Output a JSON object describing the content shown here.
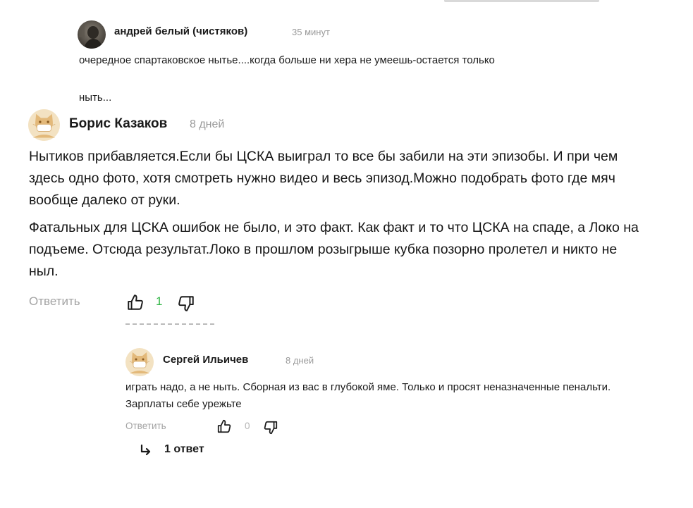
{
  "comments": [
    {
      "author": "андрей белый (чистяков)",
      "time": "35 минут",
      "text_line1": "очередное спартаковское нытье....когда больше ни хера не умеешь-остается только",
      "text_line2": "ныть..."
    },
    {
      "author": "Борис Казаков",
      "time": "8 дней",
      "paragraph1": "Нытиков прибавляется.Если бы ЦСКА выиграл то все бы забили на эти эпизобы. И при чем здесь одно фото, хотя смотреть нужно видео и весь эпизод.Можно подобрать фото где мяч вообще далеко от руки.",
      "paragraph2": "Фатальных для ЦСКА ошибок не было, и это факт. Как факт и то что ЦСКА на спаде, а Локо на подъеме. Отсюда результат.Локо в прошлом розыгрыше кубка позорно пролетел и никто не ныл.",
      "reply_label": "Ответить",
      "like_count": "1",
      "like_count_color": "#2fb443"
    },
    {
      "author": "Сергей Ильичев",
      "time": "8 дней",
      "text": "играть надо, а не ныть. Сборная из вас в глубокой яме. Только и просят неназначенные пенальти. Зарплаты себе урежьте",
      "reply_label": "Ответить",
      "like_count": "0",
      "replies_link": "1 ответ"
    }
  ],
  "icons": {
    "like": "thumbs-up-icon",
    "dislike": "thumbs-down-icon",
    "thread": "reply-arrow-icon",
    "avatar_placeholder": "cat-mask-avatar"
  },
  "colors": {
    "avatar_placeholder": "#e8c58f",
    "muted_text": "#a3a3a3",
    "positive": "#2fb443"
  }
}
